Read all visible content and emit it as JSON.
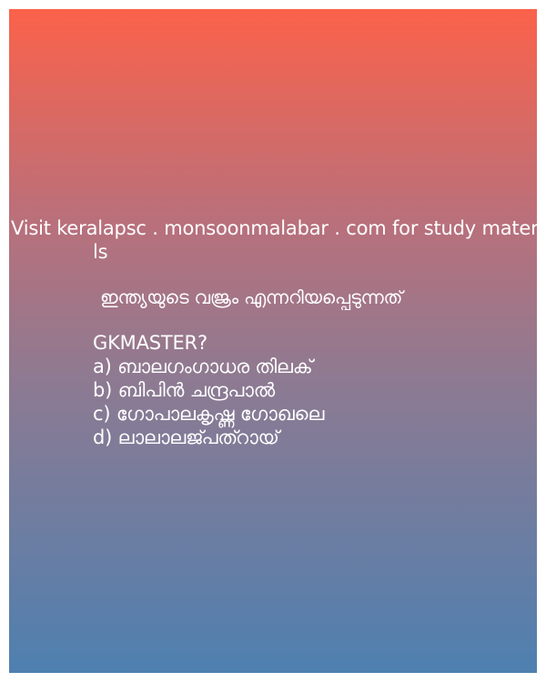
{
  "header": {
    "line1": "Visit keralapsc . monsoonmalabar . com for study materia",
    "line2": "ls"
  },
  "question": {
    "text": "ഇന്ത്യയുടെ വജ്രം എന്നറിയപ്പെടുന്നത്"
  },
  "brand": {
    "text": "GKMASTER?"
  },
  "options": [
    {
      "label": "a) ബാലഗംഗാധര തിലക്"
    },
    {
      "label": "b) ബിപിൻ ചന്ദ്രപാൽ"
    },
    {
      "label": "c) ഗോപാലകൃഷ്ണ ഗോഖലെ"
    },
    {
      "label": "d) ലാലാലജ്പത്റായ്"
    }
  ],
  "colors": {
    "gradient_top": "#fb624a",
    "gradient_bottom": "#4e80b0",
    "text": "#ffffff"
  }
}
